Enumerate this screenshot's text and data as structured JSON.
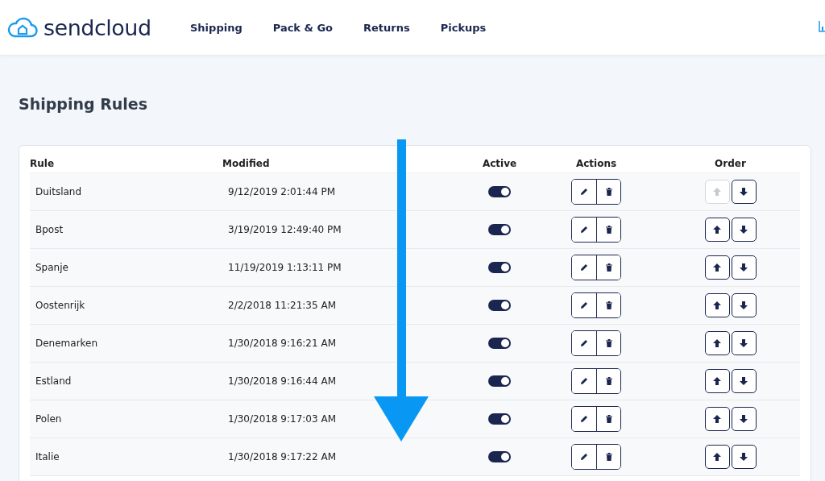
{
  "header": {
    "logo": "sendcloud",
    "nav": [
      {
        "label": "Shipping"
      },
      {
        "label": "Pack & Go"
      },
      {
        "label": "Returns"
      },
      {
        "label": "Pickups"
      }
    ]
  },
  "page_title": "Shipping Rules",
  "table": {
    "columns": [
      "Rule",
      "Modified",
      "Active",
      "Actions",
      "Order"
    ],
    "rows": [
      {
        "rule": "Duitsland",
        "modified": "9/12/2019 2:01:44 PM",
        "active": true,
        "up_disabled": true,
        "down_disabled": false
      },
      {
        "rule": "Bpost",
        "modified": "3/19/2019 12:49:40 PM",
        "active": true,
        "up_disabled": false,
        "down_disabled": false
      },
      {
        "rule": "Spanje",
        "modified": "11/19/2019 1:13:11 PM",
        "active": true,
        "up_disabled": false,
        "down_disabled": false
      },
      {
        "rule": "Oostenrijk",
        "modified": "2/2/2018 11:21:35 AM",
        "active": true,
        "up_disabled": false,
        "down_disabled": false
      },
      {
        "rule": "Denemarken",
        "modified": "1/30/2018 9:16:21 AM",
        "active": true,
        "up_disabled": false,
        "down_disabled": false
      },
      {
        "rule": "Estland",
        "modified": "1/30/2018 9:16:44 AM",
        "active": true,
        "up_disabled": false,
        "down_disabled": false
      },
      {
        "rule": "Polen",
        "modified": "1/30/2018 9:17:03 AM",
        "active": true,
        "up_disabled": false,
        "down_disabled": false
      },
      {
        "rule": "Italie",
        "modified": "1/30/2018 9:17:22 AM",
        "active": true,
        "up_disabled": false,
        "down_disabled": false
      }
    ]
  }
}
